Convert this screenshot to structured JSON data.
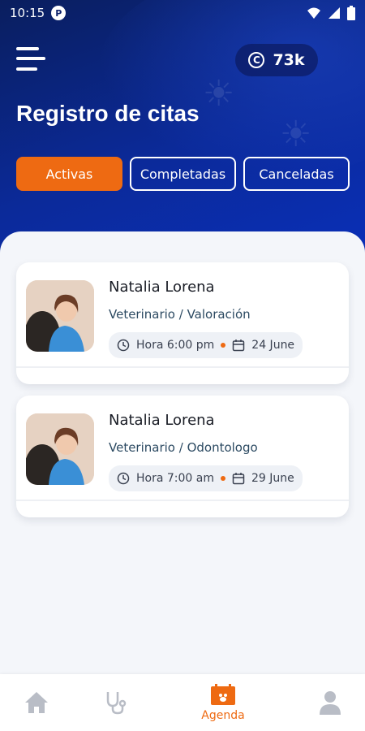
{
  "status_bar": {
    "time": "10:15",
    "app_badge": "P"
  },
  "header": {
    "coins": "73k",
    "title": "Registro de citas",
    "tabs": [
      {
        "label": "Activas",
        "active": true
      },
      {
        "label": "Completadas",
        "active": false
      },
      {
        "label": "Canceladas",
        "active": false
      }
    ]
  },
  "appointments": [
    {
      "name": "Natalia Lorena",
      "specialty": "Veterinario / Valoración",
      "time": "Hora 6:00 pm",
      "date": "24 June"
    },
    {
      "name": "Natalia Lorena",
      "specialty": "Veterinario / Odontologo",
      "time": "Hora 7:00 am",
      "date": "29 June"
    }
  ],
  "bottom_nav": {
    "items": [
      {
        "icon": "home-icon",
        "label": ""
      },
      {
        "icon": "stethoscope-icon",
        "label": ""
      },
      {
        "icon": "calendar-icon",
        "label": "Agenda",
        "active": true
      },
      {
        "icon": "profile-icon",
        "label": ""
      }
    ]
  },
  "colors": {
    "accent": "#ee6a12",
    "header": "#0b2a9a",
    "text": "#1a1d26"
  }
}
